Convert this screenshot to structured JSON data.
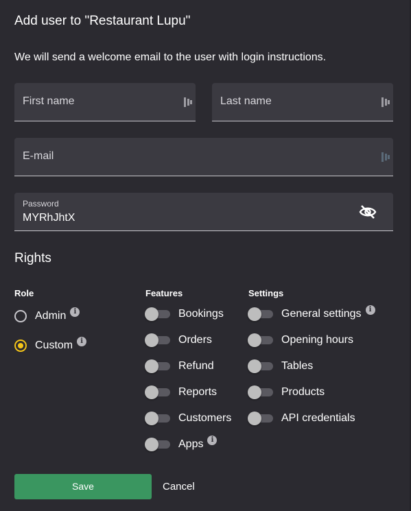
{
  "dialog": {
    "title": "Add user to \"Restaurant Lupu\"",
    "subtitle": "We will send a welcome email to the user with login instructions."
  },
  "form": {
    "first_name": {
      "placeholder": "First name",
      "value": ""
    },
    "last_name": {
      "placeholder": "Last name",
      "value": ""
    },
    "email": {
      "placeholder": "E-mail",
      "value": ""
    },
    "password": {
      "label": "Password",
      "value": "MYRhJhtX"
    }
  },
  "rights": {
    "heading": "Rights",
    "role": {
      "heading": "Role",
      "options": [
        {
          "label": "Admin",
          "checked": false
        },
        {
          "label": "Custom",
          "checked": true
        }
      ]
    },
    "features": {
      "heading": "Features",
      "items": [
        {
          "label": "Bookings",
          "on": false
        },
        {
          "label": "Orders",
          "on": false
        },
        {
          "label": "Refund",
          "on": false
        },
        {
          "label": "Reports",
          "on": false
        },
        {
          "label": "Customers",
          "on": false
        },
        {
          "label": "Apps",
          "on": false
        }
      ]
    },
    "settings": {
      "heading": "Settings",
      "items": [
        {
          "label": "General settings",
          "on": false
        },
        {
          "label": "Opening hours",
          "on": false
        },
        {
          "label": "Tables",
          "on": false
        },
        {
          "label": "Products",
          "on": false
        },
        {
          "label": "API credentials",
          "on": false
        }
      ]
    }
  },
  "actions": {
    "save_label": "Save",
    "cancel_label": "Cancel"
  },
  "colors": {
    "background": "#2b2a30",
    "field": "#3b3a41",
    "save": "#3a9660",
    "radio_selected": "#f5c518"
  },
  "icons": {
    "visibility_toggle": "eye-off-icon",
    "info": "info-icon",
    "password_manager": "password-manager-icon"
  }
}
